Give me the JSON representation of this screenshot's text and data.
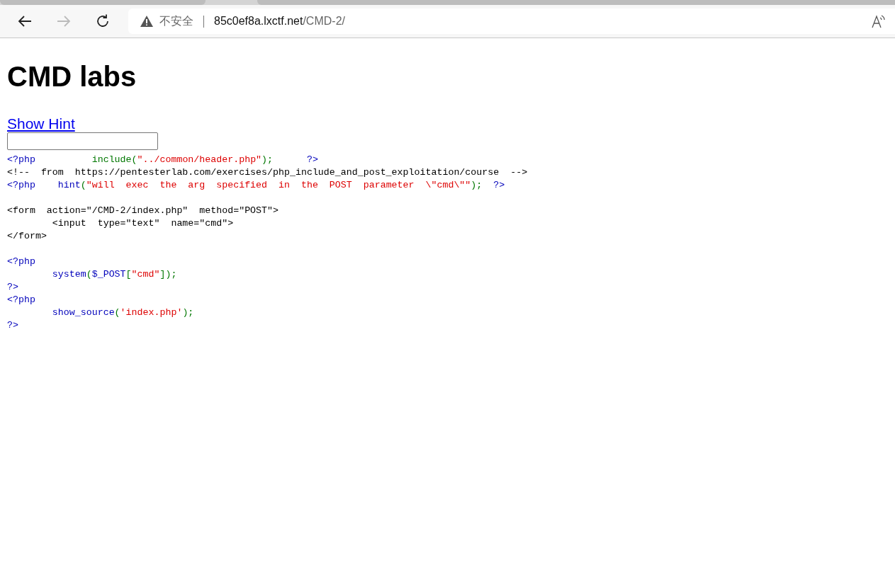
{
  "browser": {
    "security_label": "不安全",
    "url_host": "85c0ef8a.lxctf.net",
    "url_path": "/CMD-2/"
  },
  "page": {
    "heading": "CMD labs",
    "hint_link": "Show Hint",
    "code_lines": [
      {
        "kind": "code",
        "segments": [
          {
            "kind": "keyword",
            "text": "<?php"
          },
          {
            "kind": "punct",
            "text": "          include("
          },
          {
            "kind": "string",
            "text": "\"../common/header.php\""
          },
          {
            "kind": "punct",
            "text": ");"
          },
          {
            "kind": "keyword",
            "text": "      ?>"
          }
        ]
      },
      {
        "kind": "code",
        "segments": [
          {
            "kind": "plain",
            "text": "<!--  from  https://pentesterlab.com/exercises/php_include_and_post_exploitation/course  -->"
          }
        ]
      },
      {
        "kind": "code",
        "segments": [
          {
            "kind": "keyword",
            "text": "<?php    hint"
          },
          {
            "kind": "punct",
            "text": "("
          },
          {
            "kind": "string",
            "text": "\"will  exec  the  arg  specified  in  the  POST  parameter  \\\"cmd\\\"\""
          },
          {
            "kind": "punct",
            "text": ");"
          },
          {
            "kind": "keyword",
            "text": "  ?>"
          }
        ]
      },
      {
        "kind": "blank"
      },
      {
        "kind": "code",
        "segments": [
          {
            "kind": "plain",
            "text": "<form  action=\"/CMD-2/index.php\"  method=\"POST\">"
          }
        ]
      },
      {
        "kind": "code",
        "segments": [
          {
            "kind": "plain",
            "text": "        <input  type=\"text\"  name=\"cmd\">"
          }
        ]
      },
      {
        "kind": "code",
        "segments": [
          {
            "kind": "plain",
            "text": "</form>"
          }
        ]
      },
      {
        "kind": "blank"
      },
      {
        "kind": "code",
        "segments": [
          {
            "kind": "keyword",
            "text": "<?php"
          }
        ]
      },
      {
        "kind": "code",
        "segments": [
          {
            "kind": "keyword",
            "text": "        system"
          },
          {
            "kind": "punct",
            "text": "("
          },
          {
            "kind": "keyword",
            "text": "$_POST"
          },
          {
            "kind": "punct",
            "text": "["
          },
          {
            "kind": "string",
            "text": "\"cmd\""
          },
          {
            "kind": "punct",
            "text": "]);"
          }
        ]
      },
      {
        "kind": "code",
        "segments": [
          {
            "kind": "keyword",
            "text": "?>"
          }
        ]
      },
      {
        "kind": "code",
        "segments": [
          {
            "kind": "keyword",
            "text": "<?php"
          }
        ]
      },
      {
        "kind": "code",
        "segments": [
          {
            "kind": "keyword",
            "text": "        show_source"
          },
          {
            "kind": "punct",
            "text": "("
          },
          {
            "kind": "string",
            "text": "'index.php'"
          },
          {
            "kind": "punct",
            "text": ");"
          }
        ]
      },
      {
        "kind": "code",
        "segments": [
          {
            "kind": "keyword",
            "text": "?>"
          }
        ]
      }
    ]
  }
}
